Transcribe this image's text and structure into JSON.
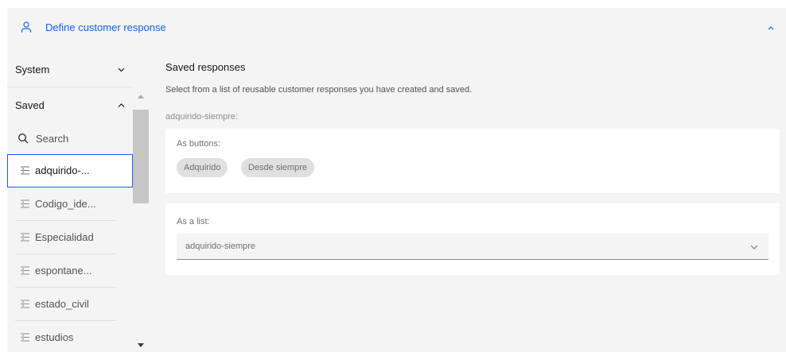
{
  "header": {
    "icon": "user-icon",
    "title": "Define customer response",
    "accent_color": "#0f62fe"
  },
  "sidebar": {
    "system_label": "System",
    "saved_label": "Saved",
    "search_placeholder": "Search",
    "items": [
      {
        "label": "adquirido-...",
        "selected": true
      },
      {
        "label": "Codigo_ide...",
        "selected": false
      },
      {
        "label": "Especialidad",
        "selected": false
      },
      {
        "label": "espontane...",
        "selected": false
      },
      {
        "label": "estado_civil",
        "selected": false
      },
      {
        "label": "estudios",
        "selected": false
      }
    ]
  },
  "main": {
    "heading": "Saved responses",
    "description": "Select from a list of reusable customer responses you have created and saved.",
    "response_name": "adquirido-siempre:",
    "buttons_label": "As buttons:",
    "chips": [
      "Adquirido",
      "Desde siempre"
    ],
    "list_label": "As a list:",
    "list_value": "adquirido-siempre"
  }
}
